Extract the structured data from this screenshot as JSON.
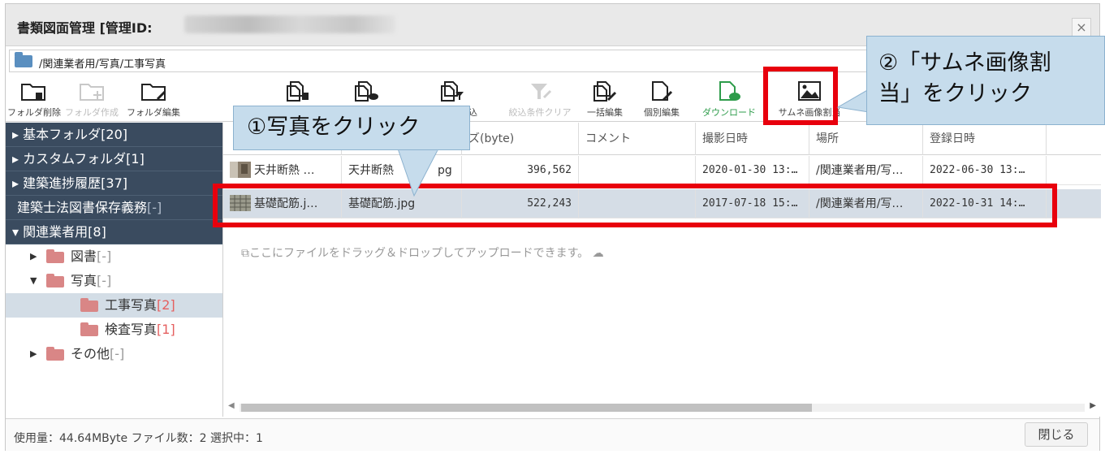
{
  "window": {
    "title": "書類図面管理  [管理ID:",
    "close_glyph": "×"
  },
  "path": {
    "text": "/関連業者用/写真/工事写真"
  },
  "toolbar": [
    {
      "name": "delete-folder-button",
      "label": "フォルダ削除",
      "state": "enabled"
    },
    {
      "name": "create-folder-button",
      "label": "フォルダ作成",
      "state": "disabled"
    },
    {
      "name": "edit-folder-button",
      "label": "フォルダ編集",
      "state": "enabled"
    },
    {
      "name": "delete-file-button",
      "label": "",
      "state": "enabled"
    },
    {
      "name": "upload-file-button",
      "label": "",
      "state": "enabled"
    },
    {
      "name": "filter-button",
      "label": "込",
      "state": "enabled"
    },
    {
      "name": "clear-filter-button",
      "label": "絞込条件クリア",
      "state": "disabled"
    },
    {
      "name": "bulk-edit-button",
      "label": "一括編集",
      "state": "enabled"
    },
    {
      "name": "individual-edit-button",
      "label": "個別編集",
      "state": "enabled"
    },
    {
      "name": "download-button",
      "label": "ダウンロード",
      "state": "green"
    },
    {
      "name": "assign-thumbnail-button",
      "label": "サムネ画像割当",
      "state": "enabled"
    }
  ],
  "sidebar": {
    "items": [
      {
        "label": "基本フォルダ",
        "count": "[20]"
      },
      {
        "label": "カスタムフォルダ",
        "count": "[1]"
      },
      {
        "label": "建築進捗履歴",
        "count": "[37]"
      },
      {
        "label": "建築士法図書保存義務",
        "count": "[-]"
      },
      {
        "label": "関連業者用",
        "count": "[8]"
      }
    ],
    "tree": [
      {
        "label": "図書",
        "count": "[-]"
      },
      {
        "label": "写真",
        "count": "[-]"
      },
      {
        "label": "工事写真",
        "count": "[2]"
      },
      {
        "label": "検査写真",
        "count": "[1]"
      },
      {
        "label": "その他",
        "count": "[-]"
      }
    ]
  },
  "table": {
    "headers": [
      "",
      "",
      "ズ(byte)",
      "コメント",
      "撮影日時",
      "場所",
      "登録日時"
    ],
    "rows": [
      {
        "title": "天井断熱 …",
        "filename": "天井断熱",
        "filename_tail": "pg",
        "size": "396,562",
        "comment": "",
        "shot": "2020-01-30 13:…",
        "place": "/関連業者用/写…",
        "registered": "2022-06-30 13:…"
      },
      {
        "title": "基礎配筋.j…",
        "filename": "基礎配筋.jpg",
        "filename_tail": "",
        "size": "522,243",
        "comment": "",
        "shot": "2017-07-18 15:…",
        "place": "/関連業者用/写…",
        "registered": "2022-10-31 14:…"
      }
    ],
    "dropzone": "ここにファイルをドラッグ＆ドロップしてアップロードできます。"
  },
  "status": {
    "text": "使用量：44.64MByte  ファイル数：2  選択中：1",
    "close_label": "閉じる"
  },
  "callouts": {
    "step1": "①写真をクリック",
    "step2_line1": "②「サムネ画像割",
    "step2_line2": "当」をクリック"
  },
  "colors": {
    "sidebar_dark": "#3a4b5f",
    "highlight_red": "#e8000d",
    "callout_fill": "#c6dcec",
    "download_green": "#2e9c4b",
    "count_red": "#e56060"
  }
}
